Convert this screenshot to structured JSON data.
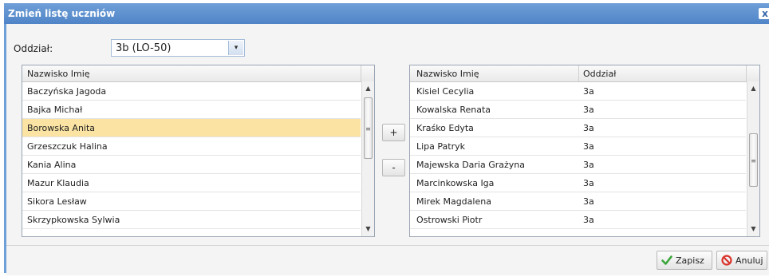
{
  "dialog": {
    "title": "Zmień listę uczniów",
    "close_glyph": "x"
  },
  "filter": {
    "label": "Oddział:",
    "selected": "3b (LO-50)",
    "arrow_glyph": "▾"
  },
  "left_grid": {
    "header": "Nazwisko Imię",
    "rows": [
      "Baczyńska Jagoda",
      "Bajka Michał",
      "Borowska Anita",
      "Grzeszczuk Halina",
      "Kania Alina",
      "Mazur Klaudia",
      "Sikora Lesław",
      "Skrzypkowska Sylwia"
    ],
    "selected_index": 2
  },
  "move_buttons": {
    "add": "+",
    "remove": "-"
  },
  "right_grid": {
    "headers": [
      "Nazwisko Imię",
      "Oddział"
    ],
    "rows": [
      [
        "Kisiel Cecylia",
        "3a"
      ],
      [
        "Kowalska Renata",
        "3a"
      ],
      [
        "Kraśko Edyta",
        "3a"
      ],
      [
        "Lipa Patryk",
        "3a"
      ],
      [
        "Majewska Daria Grażyna",
        "3a"
      ],
      [
        "Marcinkowska Iga",
        "3a"
      ],
      [
        "Mirek Magdalena",
        "3a"
      ],
      [
        "Ostrowski Piotr",
        "3a"
      ]
    ]
  },
  "scroll_glyphs": {
    "up": "▲",
    "down": "▼",
    "grip": "≡"
  },
  "footer": {
    "save_label": "Zapisz",
    "cancel_label": "Anuluj"
  },
  "colors": {
    "title_bar": "#4f84c7",
    "selected_row": "#fbe4a3",
    "save_icon": "#3aa63a",
    "cancel_icon": "#d9342b"
  },
  "icons": {
    "save": "checkmark-icon",
    "cancel": "no-entry-icon"
  }
}
